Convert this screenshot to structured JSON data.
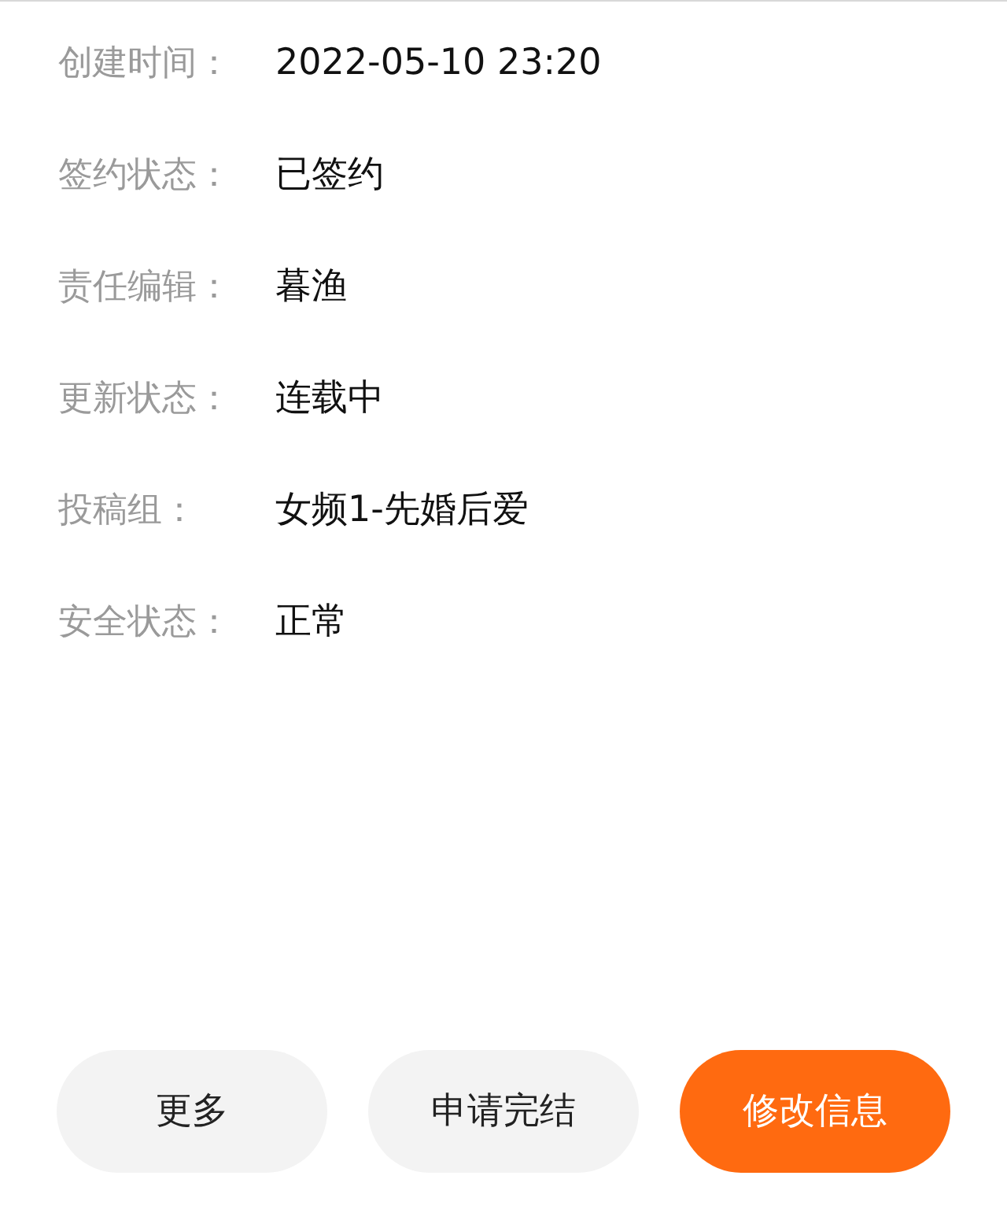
{
  "fields": [
    {
      "label": "创建时间：",
      "value": "2022-05-10 23:20"
    },
    {
      "label": "签约状态：",
      "value": "已签约"
    },
    {
      "label": "责任编辑：",
      "value": "暮渔"
    },
    {
      "label": "更新状态：",
      "value": "连载中"
    },
    {
      "label": "投稿组：",
      "value": "女频1-先婚后爱"
    },
    {
      "label": "安全状态：",
      "value": "正常"
    }
  ],
  "buttons": [
    {
      "label": "更多",
      "kind": "secondary"
    },
    {
      "label": "申请完结",
      "kind": "secondary"
    },
    {
      "label": "修改信息",
      "kind": "primary"
    }
  ]
}
